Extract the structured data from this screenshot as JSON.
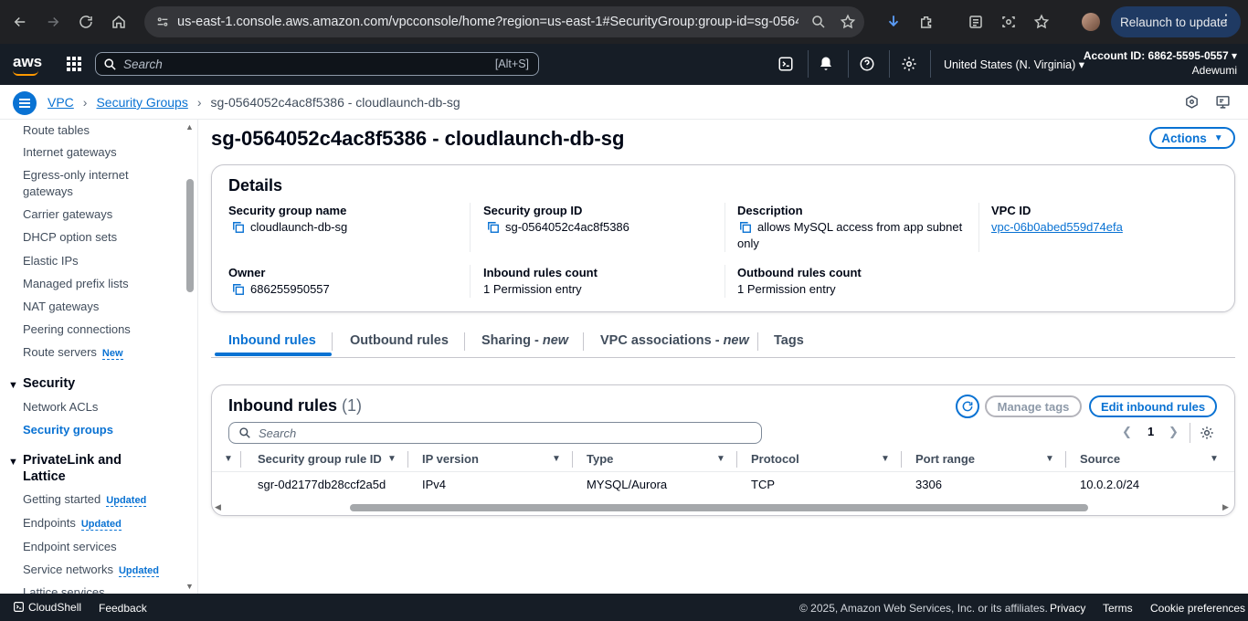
{
  "browser": {
    "url": "us-east-1.console.aws.amazon.com/vpcconsole/home?region=us-east-1#SecurityGroup:group-id=sg-05640...",
    "relaunch_label": "Relaunch to update"
  },
  "aws_nav": {
    "logo_text": "aws",
    "search_placeholder": "Search",
    "search_shortcut": "[Alt+S]",
    "region": "United States (N. Virginia) ▾",
    "account_id": "Account ID: 6862-5595-0557 ▾",
    "user": "Adewumi"
  },
  "breadcrumb": {
    "items": [
      "VPC",
      "Security Groups"
    ],
    "current": "sg-0564052c4ac8f5386 - cloudlaunch-db-sg"
  },
  "sidebar": {
    "items": [
      {
        "label": "Route tables"
      },
      {
        "label": "Internet gateways"
      },
      {
        "label": "Egress-only internet gateways"
      },
      {
        "label": "Carrier gateways"
      },
      {
        "label": "DHCP option sets"
      },
      {
        "label": "Elastic IPs"
      },
      {
        "label": "Managed prefix lists"
      },
      {
        "label": "NAT gateways"
      },
      {
        "label": "Peering connections"
      },
      {
        "label": "Route servers",
        "badge": "New"
      }
    ],
    "security_section": "Security",
    "security_items": [
      {
        "label": "Network ACLs"
      },
      {
        "label": "Security groups"
      }
    ],
    "privatelink_section": "PrivateLink and Lattice",
    "privatelink_items": [
      {
        "label": "Getting started",
        "badge": "Updated"
      },
      {
        "label": "Endpoints",
        "badge": "Updated"
      },
      {
        "label": "Endpoint services"
      },
      {
        "label": "Service networks",
        "badge": "Updated"
      },
      {
        "label": "Lattice services"
      }
    ]
  },
  "page": {
    "title": "sg-0564052c4ac8f5386 - cloudlaunch-db-sg",
    "actions_label": "Actions"
  },
  "details": {
    "title": "Details",
    "sg_name_label": "Security group name",
    "sg_name": "cloudlaunch-db-sg",
    "sg_id_label": "Security group ID",
    "sg_id": "sg-0564052c4ac8f5386",
    "description_label": "Description",
    "description": "allows MySQL access from app subnet only",
    "vpc_id_label": "VPC ID",
    "vpc_id": "vpc-06b0abed559d74efa",
    "owner_label": "Owner",
    "owner": "686255950557",
    "inbound_count_label": "Inbound rules count",
    "inbound_count": "1 Permission entry",
    "outbound_count_label": "Outbound rules count",
    "outbound_count": "1 Permission entry"
  },
  "tabs": {
    "inbound": "Inbound rules",
    "outbound": "Outbound rules",
    "sharing": "Sharing",
    "vpc_assoc": "VPC associations",
    "new_suffix": "new",
    "tags": "Tags"
  },
  "inbound_rules": {
    "title": "Inbound rules",
    "count": "(1)",
    "manage_tags": "Manage tags",
    "edit_rules": "Edit inbound rules",
    "search_placeholder": "Search",
    "page_number": "1",
    "columns": [
      "Security group rule ID",
      "IP version",
      "Type",
      "Protocol",
      "Port range",
      "Source"
    ],
    "rows": [
      {
        "rule_id": "sgr-0d2177db28ccf2a5d",
        "ip_version": "IPv4",
        "type": "MYSQL/Aurora",
        "protocol": "TCP",
        "port_range": "3306",
        "source": "10.0.2.0/24"
      }
    ]
  },
  "footer": {
    "cloudshell": "CloudShell",
    "feedback": "Feedback",
    "copyright": "© 2025, Amazon Web Services, Inc. or its affiliates.",
    "privacy": "Privacy",
    "terms": "Terms",
    "cookies": "Cookie preferences"
  },
  "colors": {
    "accent": "#0972d3",
    "nav_bg": "#161d26",
    "browser_bg": "#202124"
  }
}
